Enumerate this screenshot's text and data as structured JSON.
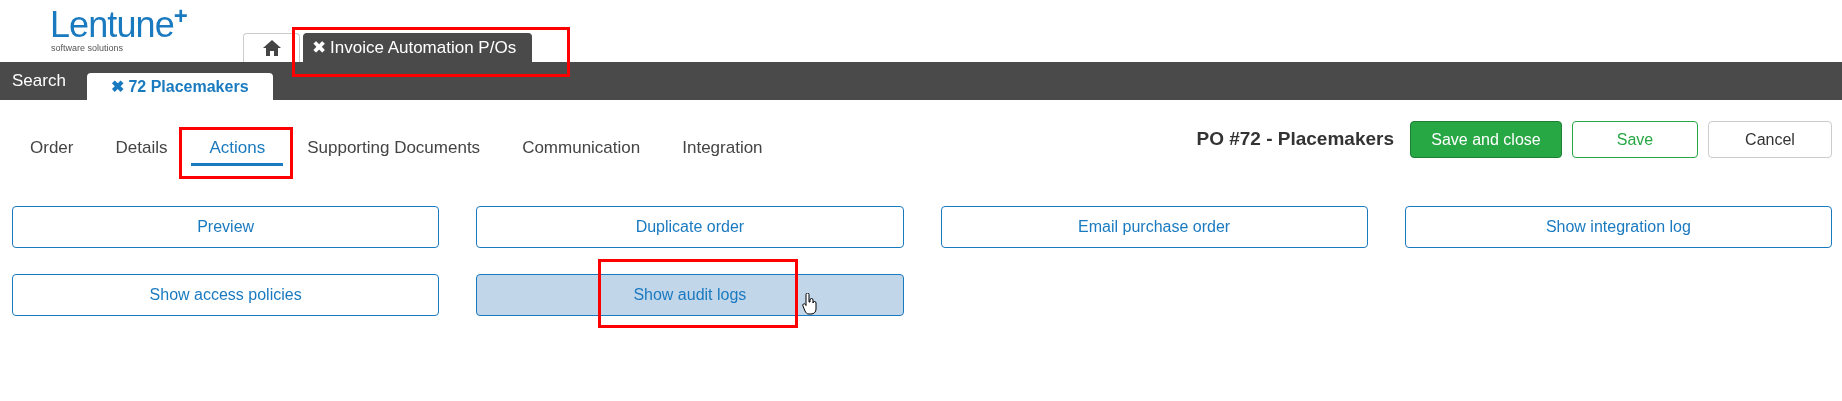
{
  "logo": {
    "name": "Lentune",
    "plus": "+",
    "tagline": "software solutions"
  },
  "top_tabs": [
    {
      "kind": "home",
      "selected": false
    },
    {
      "kind": "tab",
      "close": "✖",
      "label": "Invoice Automation P/Os",
      "selected": true,
      "highlighted": true
    }
  ],
  "sub_bar": {
    "search": "Search",
    "tabs": [
      {
        "close": "✖",
        "label": "72 Placemakers",
        "selected": true
      }
    ]
  },
  "section_tabs": [
    {
      "label": "Order",
      "selected": false,
      "highlighted": false
    },
    {
      "label": "Details",
      "selected": false,
      "highlighted": false
    },
    {
      "label": "Actions",
      "selected": true,
      "highlighted": true
    },
    {
      "label": "Supporting Documents",
      "selected": false,
      "highlighted": false
    },
    {
      "label": "Communication",
      "selected": false,
      "highlighted": false
    },
    {
      "label": "Integration",
      "selected": false,
      "highlighted": false
    }
  ],
  "title": "PO #72 - Placemakers",
  "header_buttons": [
    {
      "kind": "primary",
      "label": "Save and close"
    },
    {
      "kind": "success-outline",
      "label": "Save"
    },
    {
      "kind": "default",
      "label": "Cancel"
    }
  ],
  "action_buttons": [
    {
      "label": "Preview",
      "hovered": false,
      "highlighted": false
    },
    {
      "label": "Duplicate order",
      "hovered": false,
      "highlighted": false
    },
    {
      "label": "Email purchase order",
      "hovered": false,
      "highlighted": false
    },
    {
      "label": "Show integration log",
      "hovered": false,
      "highlighted": false
    },
    {
      "label": "Show access policies",
      "hovered": false,
      "highlighted": false
    },
    {
      "label": "Show audit logs",
      "hovered": true,
      "highlighted": true
    }
  ]
}
